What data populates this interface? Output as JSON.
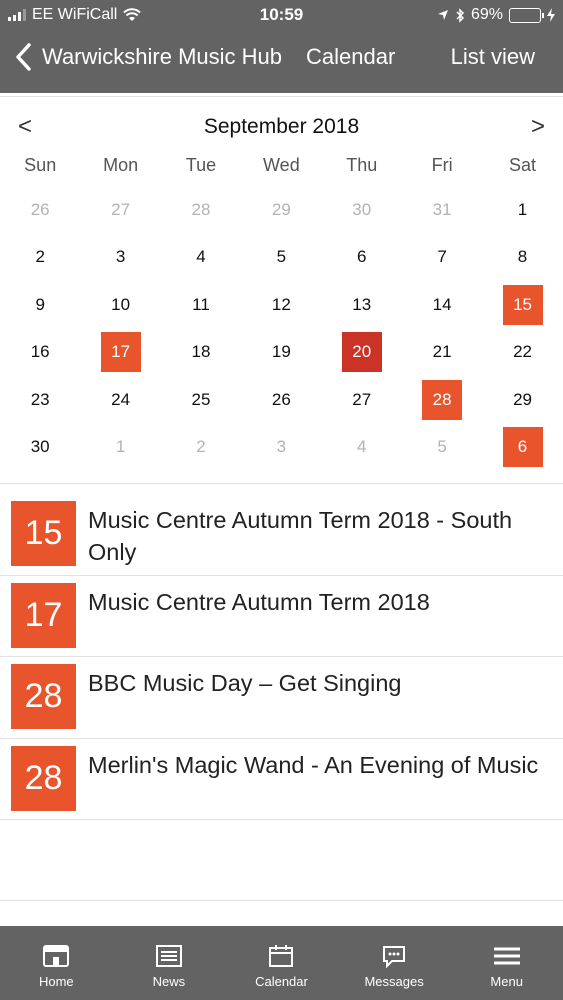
{
  "status_bar": {
    "carrier": "EE WiFiCall",
    "time": "10:59",
    "battery": "69%",
    "battery_level": 0.69
  },
  "header": {
    "title": "Warwickshire Music Hub",
    "section": "Calendar",
    "list_view_label": "List view"
  },
  "calendar": {
    "prev_label": "<",
    "next_label": ">",
    "month_label": "September 2018",
    "weekdays": [
      "Sun",
      "Mon",
      "Tue",
      "Wed",
      "Thu",
      "Fri",
      "Sat"
    ],
    "weeks": [
      [
        {
          "d": "26",
          "o": true
        },
        {
          "d": "27",
          "o": true
        },
        {
          "d": "28",
          "o": true
        },
        {
          "d": "29",
          "o": true
        },
        {
          "d": "30",
          "o": true
        },
        {
          "d": "31",
          "o": true
        },
        {
          "d": "1"
        }
      ],
      [
        {
          "d": "2"
        },
        {
          "d": "3"
        },
        {
          "d": "4"
        },
        {
          "d": "5"
        },
        {
          "d": "6"
        },
        {
          "d": "7"
        },
        {
          "d": "8"
        }
      ],
      [
        {
          "d": "9"
        },
        {
          "d": "10"
        },
        {
          "d": "11"
        },
        {
          "d": "12"
        },
        {
          "d": "13"
        },
        {
          "d": "14"
        },
        {
          "d": "15",
          "e": true
        }
      ],
      [
        {
          "d": "16"
        },
        {
          "d": "17",
          "e": true
        },
        {
          "d": "18"
        },
        {
          "d": "19"
        },
        {
          "d": "20",
          "t": true
        },
        {
          "d": "21"
        },
        {
          "d": "22"
        }
      ],
      [
        {
          "d": "23"
        },
        {
          "d": "24"
        },
        {
          "d": "25"
        },
        {
          "d": "26"
        },
        {
          "d": "27"
        },
        {
          "d": "28",
          "e": true
        },
        {
          "d": "29"
        }
      ],
      [
        {
          "d": "30"
        },
        {
          "d": "1",
          "o": true
        },
        {
          "d": "2",
          "o": true
        },
        {
          "d": "3",
          "o": true
        },
        {
          "d": "4",
          "o": true
        },
        {
          "d": "5",
          "o": true
        },
        {
          "d": "6",
          "e": true
        }
      ]
    ]
  },
  "events": [
    {
      "day": "15",
      "title": "Music Centre Autumn Term 2018 - South Only"
    },
    {
      "day": "17",
      "title": "Music Centre Autumn Term 2018"
    },
    {
      "day": "28",
      "title": "BBC Music Day – Get Singing"
    },
    {
      "day": "28",
      "title": "Merlin's Magic Wand - An Evening of Music"
    }
  ],
  "tabs": [
    {
      "label": "Home",
      "icon": "home-icon"
    },
    {
      "label": "News",
      "icon": "news-icon"
    },
    {
      "label": "Calendar",
      "icon": "calendar-icon"
    },
    {
      "label": "Messages",
      "icon": "messages-icon"
    },
    {
      "label": "Menu",
      "icon": "menu-icon"
    }
  ],
  "colors": {
    "header_bg": "#636363",
    "event_accent": "#e8542b",
    "today_accent": "#cb3327"
  }
}
